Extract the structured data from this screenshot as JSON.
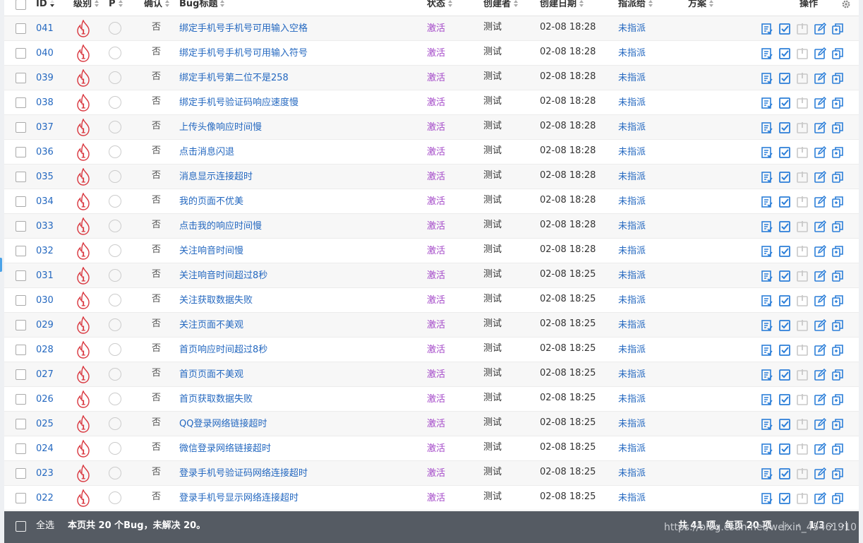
{
  "header": {
    "id": "ID",
    "severity": "级别",
    "priority": "P",
    "confirmed": "确认",
    "title": "Bug标题",
    "status": "状态",
    "creator": "创建者",
    "created_date": "创建日期",
    "assigned_to": "指派给",
    "resolution": "方案",
    "actions": "操作"
  },
  "rows": [
    {
      "id": "041",
      "severity": "1",
      "confirmed": "否",
      "title": "绑定手机号手机号可用输入空格",
      "status": "激活",
      "creator": "测试",
      "date": "02-08 18:28",
      "assigned": "未指派"
    },
    {
      "id": "040",
      "severity": "1",
      "confirmed": "否",
      "title": "绑定手机号手机号可用输入符号",
      "status": "激活",
      "creator": "测试",
      "date": "02-08 18:28",
      "assigned": "未指派"
    },
    {
      "id": "039",
      "severity": "1",
      "confirmed": "否",
      "title": "绑定手机号第二位不是258",
      "status": "激活",
      "creator": "测试",
      "date": "02-08 18:28",
      "assigned": "未指派"
    },
    {
      "id": "038",
      "severity": "1",
      "confirmed": "否",
      "title": "绑定手机号验证码响应速度慢",
      "status": "激活",
      "creator": "测试",
      "date": "02-08 18:28",
      "assigned": "未指派"
    },
    {
      "id": "037",
      "severity": "1",
      "confirmed": "否",
      "title": "上传头像响应时间慢",
      "status": "激活",
      "creator": "测试",
      "date": "02-08 18:28",
      "assigned": "未指派"
    },
    {
      "id": "036",
      "severity": "1",
      "confirmed": "否",
      "title": "点击消息闪退",
      "status": "激活",
      "creator": "测试",
      "date": "02-08 18:28",
      "assigned": "未指派"
    },
    {
      "id": "035",
      "severity": "1",
      "confirmed": "否",
      "title": "消息显示连接超时",
      "status": "激活",
      "creator": "测试",
      "date": "02-08 18:28",
      "assigned": "未指派"
    },
    {
      "id": "034",
      "severity": "1",
      "confirmed": "否",
      "title": "我的页面不优美",
      "status": "激活",
      "creator": "测试",
      "date": "02-08 18:28",
      "assigned": "未指派"
    },
    {
      "id": "033",
      "severity": "1",
      "confirmed": "否",
      "title": "点击我的响应时间慢",
      "status": "激活",
      "creator": "测试",
      "date": "02-08 18:28",
      "assigned": "未指派"
    },
    {
      "id": "032",
      "severity": "1",
      "confirmed": "否",
      "title": "关注响音时间慢",
      "status": "激活",
      "creator": "测试",
      "date": "02-08 18:28",
      "assigned": "未指派"
    },
    {
      "id": "031",
      "severity": "1",
      "confirmed": "否",
      "title": "关注响音时间超过8秒",
      "status": "激活",
      "creator": "测试",
      "date": "02-08 18:25",
      "assigned": "未指派"
    },
    {
      "id": "030",
      "severity": "1",
      "confirmed": "否",
      "title": "关注获取数据失败",
      "status": "激活",
      "creator": "测试",
      "date": "02-08 18:25",
      "assigned": "未指派"
    },
    {
      "id": "029",
      "severity": "1",
      "confirmed": "否",
      "title": "关注页面不美观",
      "status": "激活",
      "creator": "测试",
      "date": "02-08 18:25",
      "assigned": "未指派"
    },
    {
      "id": "028",
      "severity": "1",
      "confirmed": "否",
      "title": "首页响应时间超过8秒",
      "status": "激活",
      "creator": "测试",
      "date": "02-08 18:25",
      "assigned": "未指派"
    },
    {
      "id": "027",
      "severity": "1",
      "confirmed": "否",
      "title": "首页页面不美观",
      "status": "激活",
      "creator": "测试",
      "date": "02-08 18:25",
      "assigned": "未指派"
    },
    {
      "id": "026",
      "severity": "1",
      "confirmed": "否",
      "title": "首页获取数据失败",
      "status": "激活",
      "creator": "测试",
      "date": "02-08 18:25",
      "assigned": "未指派"
    },
    {
      "id": "025",
      "severity": "1",
      "confirmed": "否",
      "title": "QQ登录网络链接超时",
      "status": "激活",
      "creator": "测试",
      "date": "02-08 18:25",
      "assigned": "未指派"
    },
    {
      "id": "024",
      "severity": "1",
      "confirmed": "否",
      "title": "微信登录网络链接超时",
      "status": "激活",
      "creator": "测试",
      "date": "02-08 18:25",
      "assigned": "未指派"
    },
    {
      "id": "023",
      "severity": "1",
      "confirmed": "否",
      "title": "登录手机号验证码网络连接超时",
      "status": "激活",
      "creator": "测试",
      "date": "02-08 18:25",
      "assigned": "未指派"
    },
    {
      "id": "022",
      "severity": "1",
      "confirmed": "否",
      "title": "登录手机号显示网络连接超时",
      "status": "激活",
      "creator": "测试",
      "date": "02-08 18:25",
      "assigned": "未指派"
    }
  ],
  "footer": {
    "select_all": "全选",
    "summary": "本页共 20 个Bug，未解决 20。",
    "total": "共 41 项，每页 20 项",
    "page": "1/3",
    "watermark": "https://blog.csdn.net/weixin_45461910"
  },
  "colors": {
    "link": "#2468c0",
    "status_active": "#a347c8",
    "severity_red": "#d9363e",
    "action_blue": "#2b7ed8",
    "footer_bg": "#555b63"
  },
  "icons": [
    "fire-severity-icon",
    "confirm-bug-icon",
    "resolve-bug-icon",
    "close-bug-icon",
    "edit-bug-icon",
    "copy-bug-icon",
    "settings-gear-icon"
  ]
}
